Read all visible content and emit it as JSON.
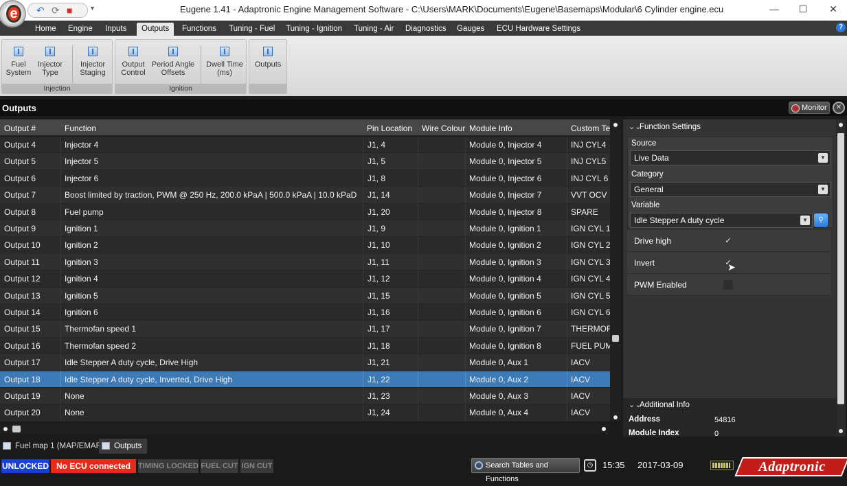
{
  "window": {
    "title": "Eugene 1.41 - Adaptronic Engine Management Software - C:\\Users\\MARK\\Documents\\Eugene\\Basemaps\\Modular\\6 Cylinder engine.ecu",
    "logo_letter": "e",
    "minimize_glyph": "—",
    "maximize_glyph": "☐",
    "close_glyph": "✕"
  },
  "ribbon_tabs": [
    "Home",
    "Engine",
    "Inputs",
    "Outputs",
    "Functions",
    "Tuning - Fuel",
    "Tuning - Ignition",
    "Tuning - Air",
    "Diagnostics",
    "Gauges",
    "ECU Hardware Settings"
  ],
  "active_ribbon_tab": "Outputs",
  "help_glyph": "?",
  "ribbon": {
    "groups": [
      {
        "label": "Injection",
        "buttons": [
          {
            "line1": "Fuel",
            "line2": "System"
          },
          {
            "line1": "Injector",
            "line2": "Type"
          },
          {
            "line1": "Injector",
            "line2": "Staging"
          }
        ]
      },
      {
        "label": "Ignition",
        "buttons": [
          {
            "line1": "Output",
            "line2": "Control"
          },
          {
            "line1": "Period Angle",
            "line2": "Offsets"
          },
          {
            "line1": "Dwell Time",
            "line2": "(ms)"
          }
        ]
      },
      {
        "label": "",
        "buttons": [
          {
            "line1": "Outputs",
            "line2": ""
          }
        ]
      }
    ]
  },
  "outputs_panel": {
    "title": "Outputs",
    "monitor_label": "Monitor",
    "close_glyph": "✕"
  },
  "grid": {
    "columns": [
      "Output #",
      "Function",
      "Pin Location",
      "Wire Colour",
      "Module Info",
      "Custom Te"
    ],
    "rows": [
      {
        "output": "Output 4",
        "function": "Injector 4",
        "pin": "J1,  4",
        "wire": "",
        "module": "Module 0, Injector 4",
        "custom": "INJ CYL4"
      },
      {
        "output": "Output 5",
        "function": "Injector 5",
        "pin": "J1,  5",
        "wire": "",
        "module": "Module 0, Injector 5",
        "custom": "INJ CYL5"
      },
      {
        "output": "Output 6",
        "function": "Injector 6",
        "pin": "J1,  8",
        "wire": "",
        "module": "Module 0, Injector 6",
        "custom": "INJ CYL 6"
      },
      {
        "output": "Output 7",
        "function": "Boost limited by traction, PWM @ 250 Hz, 200.0 kPaA | 500.0 kPaA | 10.0 kPaD",
        "pin": "J1, 14",
        "wire": "",
        "module": "Module 0, Injector 7",
        "custom": "VVT OCV"
      },
      {
        "output": "Output 8",
        "function": "Fuel pump",
        "pin": "J1, 20",
        "wire": "",
        "module": "Module 0, Injector 8",
        "custom": "SPARE"
      },
      {
        "output": "Output 9",
        "function": "Ignition 1",
        "pin": "J1,  9",
        "wire": "",
        "module": "Module 0, Ignition 1",
        "custom": "IGN CYL 1"
      },
      {
        "output": "Output 10",
        "function": "Ignition 2",
        "pin": "J1, 10",
        "wire": "",
        "module": "Module 0, Ignition 2",
        "custom": "IGN CYL 2"
      },
      {
        "output": "Output 11",
        "function": "Ignition 3",
        "pin": "J1, 11",
        "wire": "",
        "module": "Module 0, Ignition 3",
        "custom": "IGN CYL 3"
      },
      {
        "output": "Output 12",
        "function": "Ignition 4",
        "pin": "J1, 12",
        "wire": "",
        "module": "Module 0, Ignition 4",
        "custom": "IGN CYL 4"
      },
      {
        "output": "Output 13",
        "function": "Ignition 5",
        "pin": "J1, 15",
        "wire": "",
        "module": "Module 0, Ignition 5",
        "custom": "IGN CYL 5"
      },
      {
        "output": "Output 14",
        "function": "Ignition 6",
        "pin": "J1, 16",
        "wire": "",
        "module": "Module 0, Ignition 6",
        "custom": "IGN CYL 6"
      },
      {
        "output": "Output 15",
        "function": "Thermofan speed 1",
        "pin": "J1, 17",
        "wire": "",
        "module": "Module 0, Ignition 7",
        "custom": "THERMOFA"
      },
      {
        "output": "Output 16",
        "function": "Thermofan speed 2",
        "pin": "J1, 18",
        "wire": "",
        "module": "Module 0, Ignition 8",
        "custom": "FUEL PUMP"
      },
      {
        "output": "Output 17",
        "function": "Idle Stepper A duty cycle, Drive High",
        "pin": "J1, 21",
        "wire": "",
        "module": "Module 0, Aux 1",
        "custom": "IACV"
      },
      {
        "output": "Output 18",
        "function": "Idle Stepper A duty cycle, Inverted, Drive High",
        "pin": "J1, 22",
        "wire": "",
        "module": "Module 0, Aux 2",
        "custom": "IACV"
      },
      {
        "output": "Output 19",
        "function": "None",
        "pin": "J1, 23",
        "wire": "",
        "module": "Module 0, Aux 3",
        "custom": "IACV"
      },
      {
        "output": "Output 20",
        "function": "None",
        "pin": "J1, 24",
        "wire": "",
        "module": "Module 0, Aux 4",
        "custom": "IACV"
      }
    ],
    "selected_output": "Output 18"
  },
  "function_settings": {
    "header": "Function Settings",
    "source_label": "Source",
    "source_value": "Live Data",
    "category_label": "Category",
    "category_value": "General",
    "variable_label": "Variable",
    "variable_value": "Idle Stepper A duty cycle",
    "options": [
      {
        "label": "Drive high",
        "checked": true
      },
      {
        "label": "Invert",
        "checked": true
      },
      {
        "label": "PWM Enabled",
        "checked": false
      }
    ],
    "check_glyph": "✓",
    "dropdown_glyph": "▼"
  },
  "additional_info": {
    "header": "Additional Info",
    "address_label": "Address",
    "address_value": "54816",
    "module_index_label": "Module Index",
    "module_index_value": "0"
  },
  "doc_tabs": [
    "Fuel map 1 (MAP/EMAP)",
    "Outputs"
  ],
  "active_doc_tab": "Outputs",
  "status": {
    "unlocked": "UNLOCKED",
    "no_ecu": "No ECU connected",
    "timing_locked": "TIMING LOCKED",
    "fuel_cut": "FUEL CUT",
    "ign_cut": "IGN CUT",
    "search_label": "Search Tables and Functions",
    "time": "15:35",
    "date": "2017-03-09",
    "brand": "Adaptronic",
    "colors": {
      "unlocked_bg": "#1a3fd6",
      "no_ecu_bg": "#e8291c",
      "inactive_bg": "#3a3a3a",
      "selection": "#3d7ab8"
    }
  }
}
